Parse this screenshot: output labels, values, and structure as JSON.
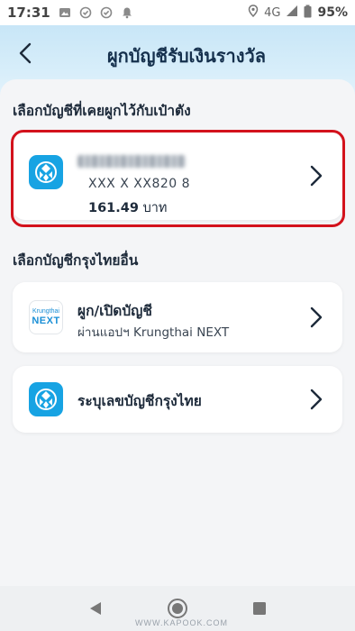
{
  "status_bar": {
    "time": "17:31",
    "network": "4G",
    "battery": "95%",
    "left_icons": [
      "image-icon",
      "check-circle-icon",
      "check-circle-icon",
      "bell-icon"
    ],
    "right_icons": [
      "location-icon",
      "signal-icon",
      "battery-icon"
    ]
  },
  "header": {
    "title": "ผูกบัญชีรับเงินรางวัล",
    "back_icon": "chevron-left-icon"
  },
  "linked_section": {
    "title": "เลือกบัญชีที่เคยผูกไว้กับเป๋าตัง",
    "account": {
      "number": "XXX X XX820 8",
      "balance_amount": "161.49",
      "balance_unit": "บาท",
      "highlight_color": "#d3121c"
    }
  },
  "other_section": {
    "title": "เลือกบัญชีกรุงไทยอื่น",
    "items": [
      {
        "title": "ผูก/เปิดบัญชี",
        "subtitle": "ผ่านแอปฯ Krungthai NEXT",
        "logo_top": "Krungthai",
        "logo_bottom": "NEXT"
      },
      {
        "title": "ระบุเลขบัญชีกรุงไทย"
      }
    ]
  },
  "nav": {
    "icons": [
      "back-triangle-icon",
      "home-circle-icon",
      "recents-square-icon"
    ]
  },
  "watermark": "WWW.KAPOOK.COM",
  "colors": {
    "brand_blue": "#17a3e3",
    "header_gradient_top": "#c8e6f7",
    "highlight_red": "#d3121c"
  }
}
